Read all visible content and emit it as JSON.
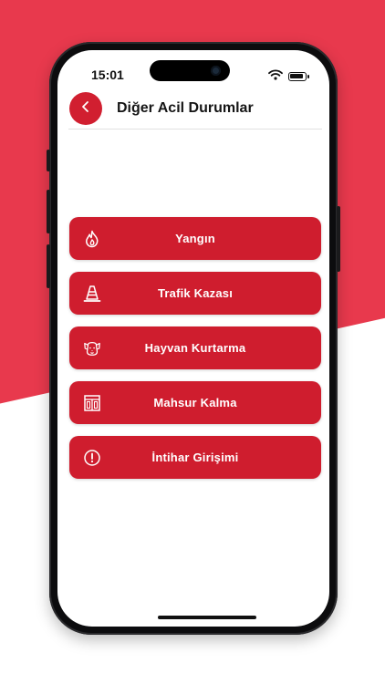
{
  "status_bar": {
    "time": "15:01",
    "icons": [
      "wifi-icon",
      "battery-icon"
    ]
  },
  "header": {
    "back_icon": "chevron-left-icon",
    "title": "Diğer Acil Durumlar"
  },
  "menu": {
    "items": [
      {
        "label": "Yangın",
        "icon": "flame-icon"
      },
      {
        "label": "Trafik Kazası",
        "icon": "traffic-cone-icon"
      },
      {
        "label": "Hayvan Kurtarma",
        "icon": "dog-icon"
      },
      {
        "label": "Mahsur Kalma",
        "icon": "elevator-icon"
      },
      {
        "label": "İntihar Girişimi",
        "icon": "alert-circle-icon"
      }
    ]
  },
  "colors": {
    "background_accent": "#e8394d",
    "button_red": "#cf1d2e",
    "text_dark": "#151515",
    "text_light": "#ffffff"
  }
}
